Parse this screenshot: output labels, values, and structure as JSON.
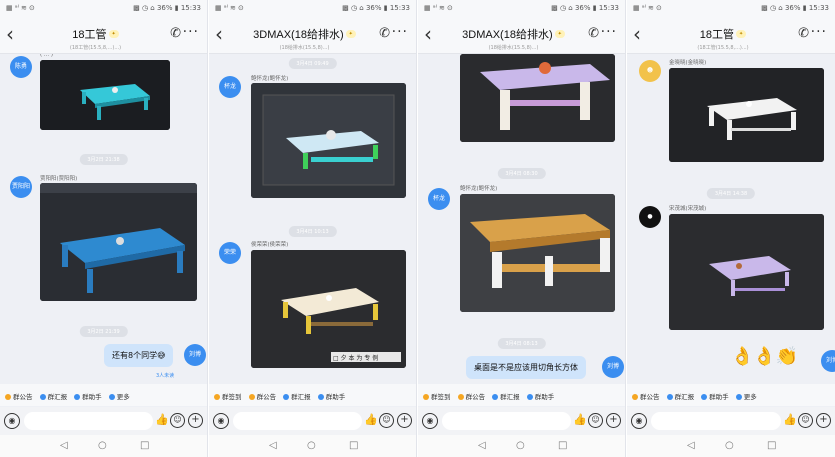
{
  "status": {
    "left": "▦ ᵃˡ ≋ ⊙",
    "right": "▩ ◷ ⌂ 36% ▮ 15:33"
  },
  "phones": [
    {
      "title": "18工管",
      "subtitle": "(18工管(15.5,8,...)...)",
      "avatars": [
        "陈勇",
        "贾阳阳",
        "刘博"
      ],
      "senders": [
        "( ... )",
        "贾阳阳(贾阳阳)"
      ],
      "times": [
        "3月2日 21:38",
        "3月2日 21:39"
      ],
      "bubble": "还有8个同学😅",
      "read": "3人未读"
    },
    {
      "title": "3DMAX(18给排水)",
      "subtitle": "(18给排水(15.5,8)...)",
      "avatars": [
        "杯龙",
        "荣荣"
      ],
      "senders": [
        "鲍怀龙(鲍怀龙)",
        "侯荣荣(侯荣荣)"
      ],
      "times": [
        "3月4日 09:49",
        "3月4日 10:13"
      ],
      "watermark": "□ 夕 本 为 专 例"
    },
    {
      "title": "3DMAX(18给排水)",
      "subtitle": "(18给排水(15.5,8)...)",
      "avatars": [
        "杯龙",
        "刘博"
      ],
      "senders": [
        "鲍怀龙(鲍怀龙)"
      ],
      "times": [
        "3月4日 08:30",
        "3月4日 08:13"
      ],
      "bubble": "桌面是不是应该用切角长方体"
    },
    {
      "title": "18工管",
      "subtitle": "(18工管(15.5,8,...)...)",
      "avatars": [
        "刘博"
      ],
      "senders": [
        "金晓晓(金晓晓)",
        "宋茂城(宋茂城)"
      ],
      "times": [
        "3月4日 14:38"
      ],
      "emojis": "👌👌👏"
    }
  ],
  "toolbar_items": [
    "群签到",
    "群公告",
    "群汇报",
    "群助手",
    "更多"
  ],
  "toolbar_colors": [
    "#f5a623",
    "#f5a623",
    "#3b8ef0",
    "#3b8ef0",
    "#3b8ef0"
  ],
  "icons": [
    "back-icon",
    "phone-call-icon",
    "more-icon",
    "voice-icon",
    "thumb-up-icon",
    "emoji-icon",
    "plus-icon",
    "nav-back-icon",
    "nav-home-icon",
    "nav-recent-icon"
  ]
}
